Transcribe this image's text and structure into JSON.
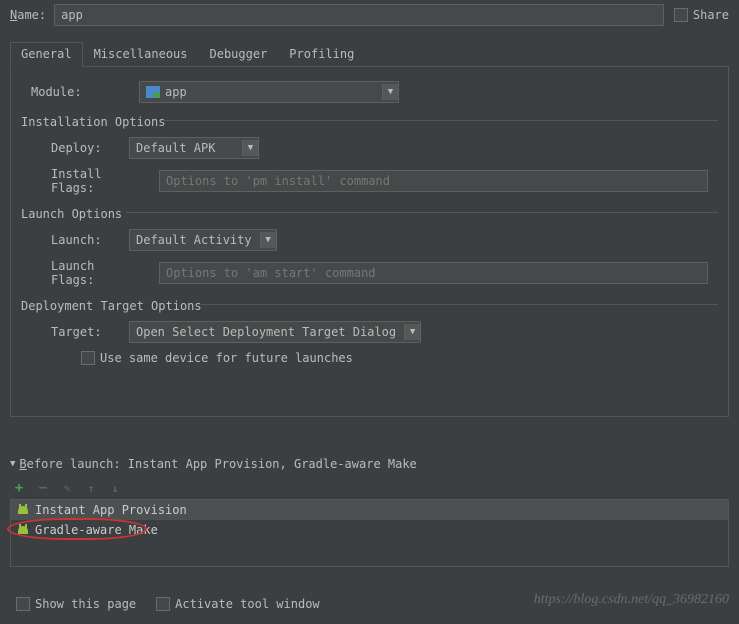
{
  "name": {
    "label": "Name:",
    "value": "app"
  },
  "share": {
    "label": "Share"
  },
  "tabs": [
    {
      "label": "General",
      "active": true
    },
    {
      "label": "Miscellaneous",
      "active": false
    },
    {
      "label": "Debugger",
      "active": false
    },
    {
      "label": "Profiling",
      "active": false
    }
  ],
  "module": {
    "label": "Module:",
    "value": "app"
  },
  "installation": {
    "title": "Installation Options",
    "deploy": {
      "label": "Deploy:",
      "value": "Default APK"
    },
    "flags": {
      "label": "Install Flags:",
      "placeholder": "Options to 'pm install' command"
    }
  },
  "launch_opts": {
    "title": "Launch Options",
    "launch": {
      "label": "Launch:",
      "value": "Default Activity"
    },
    "flags": {
      "label": "Launch Flags:",
      "placeholder": "Options to 'am start' command"
    }
  },
  "deploy_target": {
    "title": "Deployment Target Options",
    "target": {
      "label": "Target:",
      "value": "Open Select Deployment Target Dialog"
    },
    "same_device": "Use same device for future launches"
  },
  "before_launch": {
    "title": "Before launch: Instant App Provision, Gradle-aware Make",
    "tasks": [
      "Instant App Provision",
      "Gradle-aware Make"
    ]
  },
  "bottom": {
    "show_page": "Show this page",
    "activate_tool": "Activate tool window"
  },
  "watermark": "https://blog.csdn.net/qq_36982160"
}
